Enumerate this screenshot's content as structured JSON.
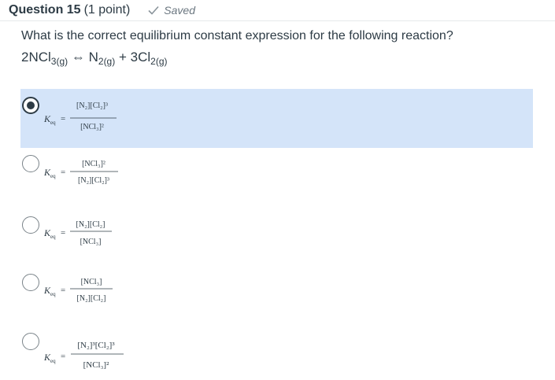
{
  "header": {
    "title": "Question 15",
    "points": "(1 point)",
    "saved_label": "Saved"
  },
  "question": {
    "prompt": "What is the correct equilibrium constant expression for the following reaction?",
    "reaction": {
      "reactant": "2NCl",
      "reactant_sub": "3(g)",
      "arrow": "⇔",
      "product1": "N",
      "product1_sub": "2(g)",
      "plus": "+",
      "product2": "3Cl",
      "product2_sub": "2(g)"
    }
  },
  "answers": [
    {
      "selected": true,
      "k": "K",
      "k_sub": "eq",
      "eq": "=",
      "numerator": "[N₂][Cl₂]³",
      "denominator": "[NCl₃]²"
    },
    {
      "selected": false,
      "k": "K",
      "k_sub": "eq",
      "eq": "=",
      "numerator": "[NCl₃]²",
      "denominator": "[N₂][Cl₂]³"
    },
    {
      "selected": false,
      "k": "K",
      "k_sub": "eq",
      "eq": "=",
      "numerator": "[N₂][Cl₂]",
      "denominator": "[NCl₃]"
    },
    {
      "selected": false,
      "k": "K",
      "k_sub": "eq",
      "eq": "=",
      "numerator": "[NCl₃]",
      "denominator": "[N₂][Cl₂]"
    },
    {
      "selected": false,
      "k": "K",
      "k_sub": "eq",
      "eq": "=",
      "numerator": "[N₂]³[Cl₂]³",
      "denominator": "[NCl₃]²"
    }
  ],
  "colors": {
    "selected_bg": "#d4e4f9",
    "text": "#2d3b45",
    "muted": "#6b7780"
  }
}
